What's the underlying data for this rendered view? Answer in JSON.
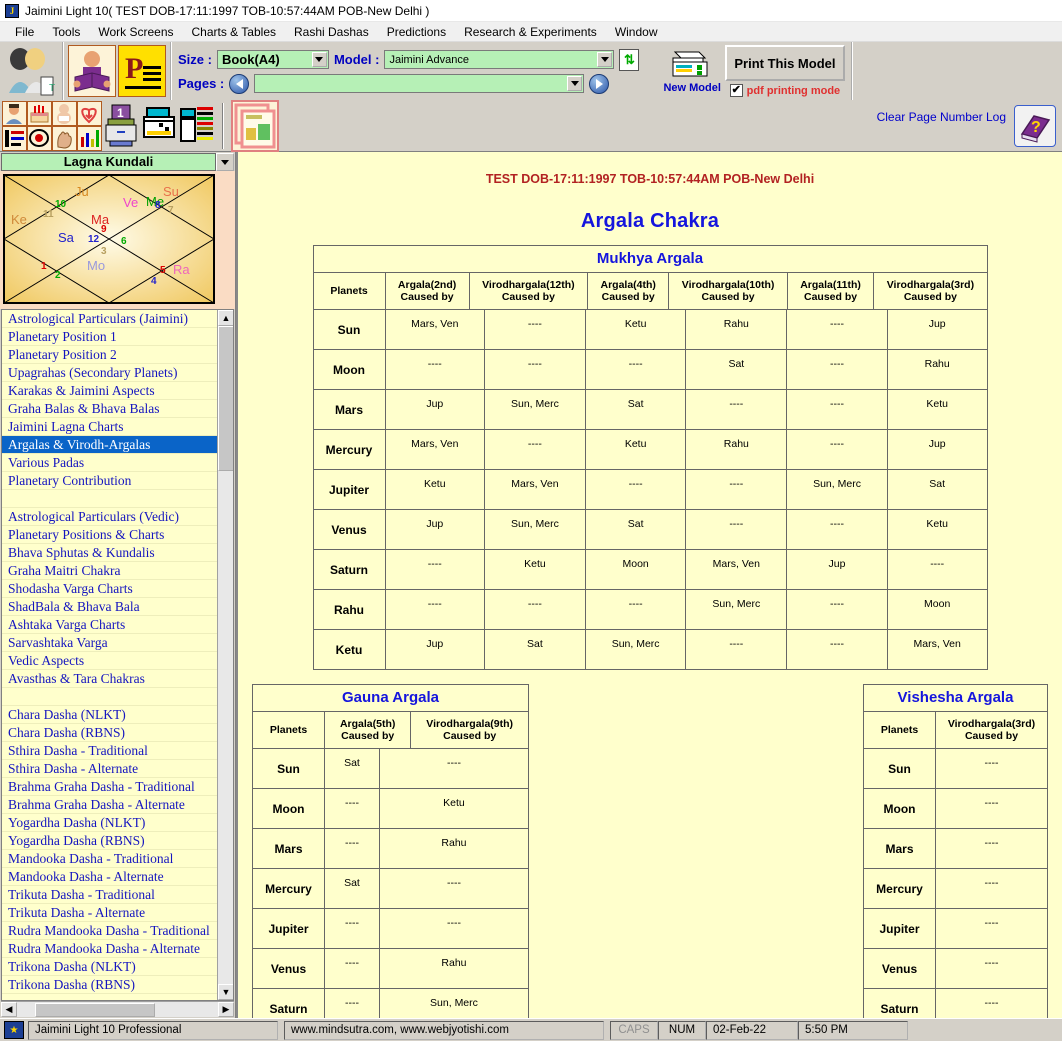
{
  "window": {
    "title": "Jaimini Light 10( TEST DOB-17:11:1997 TOB-10:57:44AM POB-New Delhi )",
    "app_icon": "J"
  },
  "menu": {
    "items": [
      "File",
      "Tools",
      "Work Screens",
      "Charts & Tables",
      "Rashi Dashas",
      "Predictions",
      "Research & Experiments",
      "Window"
    ]
  },
  "toolbar": {
    "size_label": "Size :",
    "size_value": "Book(A4)",
    "model_label": "Model :",
    "model_value": "Jaimini Advance",
    "pages_label": "Pages :",
    "pages_value": "",
    "new_model_label": "New Model",
    "print_label": "Print This Model",
    "pdf_checkbox_label": "pdf printing mode",
    "pdf_checked": "✔",
    "clear_log_label": "Clear Page Number Log"
  },
  "sidebar": {
    "header": "Lagna Kundali",
    "chart": {
      "planets": [
        {
          "name": "Ju",
          "color": "#d88a22"
        },
        {
          "name": "Su",
          "color": "#e8704a"
        },
        {
          "name": "Me",
          "color": "#00a000"
        },
        {
          "name": "Ve",
          "color": "#ee44cc"
        },
        {
          "name": "Ke",
          "color": "#d08a3a"
        },
        {
          "name": "Ma",
          "color": "#dd2222"
        },
        {
          "name": "Sa",
          "color": "#2222cc"
        },
        {
          "name": "Mo",
          "color": "#9999dd"
        },
        {
          "name": "Ra",
          "color": "#ee66bb"
        }
      ],
      "houses": [
        "1",
        "2",
        "3",
        "4",
        "5",
        "6",
        "7",
        "8",
        "9",
        "10",
        "11",
        "12"
      ]
    },
    "items": [
      {
        "label": "Astrological Particulars (Jaimini)",
        "selected": false
      },
      {
        "label": "Planetary Position 1",
        "selected": false
      },
      {
        "label": "Planetary Position 2",
        "selected": false
      },
      {
        "label": "Upagrahas (Secondary Planets)",
        "selected": false
      },
      {
        "label": "Karakas & Jaimini Aspects",
        "selected": false
      },
      {
        "label": "Graha Balas & Bhava Balas",
        "selected": false
      },
      {
        "label": "Jaimini Lagna Charts",
        "selected": false
      },
      {
        "label": "Argalas & Virodh-Argalas",
        "selected": true
      },
      {
        "label": "Various Padas",
        "selected": false
      },
      {
        "label": "Planetary Contribution",
        "selected": false
      },
      {
        "label": "",
        "selected": false
      },
      {
        "label": "Astrological Particulars (Vedic)",
        "selected": false
      },
      {
        "label": "Planetary Positions & Charts",
        "selected": false
      },
      {
        "label": "Bhava Sphutas & Kundalis",
        "selected": false
      },
      {
        "label": "Graha Maitri Chakra",
        "selected": false
      },
      {
        "label": "Shodasha Varga Charts",
        "selected": false
      },
      {
        "label": "ShadBala & Bhava Bala",
        "selected": false
      },
      {
        "label": "Ashtaka Varga Charts",
        "selected": false
      },
      {
        "label": "Sarvashtaka Varga",
        "selected": false
      },
      {
        "label": "Vedic Aspects",
        "selected": false
      },
      {
        "label": "Avasthas & Tara Chakras",
        "selected": false
      },
      {
        "label": "",
        "selected": false
      },
      {
        "label": "Chara Dasha (NLKT)",
        "selected": false
      },
      {
        "label": "Chara Dasha (RBNS)",
        "selected": false
      },
      {
        "label": "Sthira Dasha - Traditional",
        "selected": false
      },
      {
        "label": "Sthira Dasha - Alternate",
        "selected": false
      },
      {
        "label": "Brahma Graha Dasha - Traditional",
        "selected": false
      },
      {
        "label": "Brahma Graha Dasha - Alternate",
        "selected": false
      },
      {
        "label": "Yogardha Dasha (NLKT)",
        "selected": false
      },
      {
        "label": "Yogardha Dasha (RBNS)",
        "selected": false
      },
      {
        "label": "Mandooka Dasha - Traditional",
        "selected": false
      },
      {
        "label": "Mandooka Dasha - Alternate",
        "selected": false
      },
      {
        "label": "Trikuta Dasha - Traditional",
        "selected": false
      },
      {
        "label": "Trikuta Dasha - Alternate",
        "selected": false
      },
      {
        "label": "Rudra Mandooka Dasha - Traditional",
        "selected": false
      },
      {
        "label": "Rudra Mandooka Dasha - Alternate",
        "selected": false
      },
      {
        "label": "Trikona Dasha (NLKT)",
        "selected": false
      },
      {
        "label": "Trikona Dasha (RBNS)",
        "selected": false
      }
    ]
  },
  "content": {
    "subject_line": "TEST DOB-17:11:1997 TOB-10:57:44AM POB-New Delhi",
    "page_title": "Argala Chakra",
    "mukhya": {
      "caption": "Mukhya Argala",
      "columns": [
        "Planets",
        "Argala(2nd) Caused by",
        "Virodhargala(12th) Caused by",
        "Argala(4th) Caused by",
        "Virodhargala(10th) Caused by",
        "Argala(11th) Caused by",
        "Virodhargala(3rd) Caused by"
      ],
      "rows": [
        {
          "planet": "Sun",
          "values": [
            "Mars, Ven",
            "----",
            "Ketu",
            "Rahu",
            "----",
            "Jup"
          ]
        },
        {
          "planet": "Moon",
          "values": [
            "----",
            "----",
            "----",
            "Sat",
            "----",
            "Rahu"
          ]
        },
        {
          "planet": "Mars",
          "values": [
            "Jup",
            "Sun, Merc",
            "Sat",
            "----",
            "----",
            "Ketu"
          ]
        },
        {
          "planet": "Mercury",
          "values": [
            "Mars, Ven",
            "----",
            "Ketu",
            "Rahu",
            "----",
            "Jup"
          ]
        },
        {
          "planet": "Jupiter",
          "values": [
            "Ketu",
            "Mars, Ven",
            "----",
            "----",
            "Sun, Merc",
            "Sat"
          ]
        },
        {
          "planet": "Venus",
          "values": [
            "Jup",
            "Sun, Merc",
            "Sat",
            "----",
            "----",
            "Ketu"
          ]
        },
        {
          "planet": "Saturn",
          "values": [
            "----",
            "Ketu",
            "Moon",
            "Mars, Ven",
            "Jup",
            "----"
          ]
        },
        {
          "planet": "Rahu",
          "values": [
            "----",
            "----",
            "----",
            "Sun, Merc",
            "----",
            "Moon"
          ]
        },
        {
          "planet": "Ketu",
          "values": [
            "Jup",
            "Sat",
            "Sun, Merc",
            "----",
            "----",
            "Mars, Ven"
          ]
        }
      ]
    },
    "gauna": {
      "caption": "Gauna Argala",
      "columns": [
        "Planets",
        "Argala(5th) Caused by",
        "Virodhargala(9th) Caused by"
      ],
      "rows": [
        {
          "planet": "Sun",
          "values": [
            "Sat",
            "----"
          ]
        },
        {
          "planet": "Moon",
          "values": [
            "----",
            "Ketu"
          ]
        },
        {
          "planet": "Mars",
          "values": [
            "----",
            "Rahu"
          ]
        },
        {
          "planet": "Mercury",
          "values": [
            "Sat",
            "----"
          ]
        },
        {
          "planet": "Jupiter",
          "values": [
            "----",
            "----"
          ]
        },
        {
          "planet": "Venus",
          "values": [
            "----",
            "Rahu"
          ]
        },
        {
          "planet": "Saturn",
          "values": [
            "----",
            "Sun, Merc"
          ]
        }
      ]
    },
    "vishesha": {
      "caption": "Vishesha Argala",
      "columns": [
        "Planets",
        "Virodhargala(3rd) Caused by"
      ],
      "rows": [
        {
          "planet": "Sun",
          "values": [
            "----"
          ]
        },
        {
          "planet": "Moon",
          "values": [
            "----"
          ]
        },
        {
          "planet": "Mars",
          "values": [
            "----"
          ]
        },
        {
          "planet": "Mercury",
          "values": [
            "----"
          ]
        },
        {
          "planet": "Jupiter",
          "values": [
            "----"
          ]
        },
        {
          "planet": "Venus",
          "values": [
            "----"
          ]
        },
        {
          "planet": "Saturn",
          "values": [
            "----"
          ]
        }
      ]
    }
  },
  "statusbar": {
    "app_name": "Jaimini Light 10 Professional",
    "websites": "www.mindsutra.com, www.webjyotishi.com",
    "caps": "CAPS",
    "num": "NUM",
    "date": "02-Feb-22",
    "time": "5:50 PM"
  },
  "colors": {
    "content_bg": "#FFFFCC",
    "accent_blue": "#1515DD",
    "subject_red": "#B22222",
    "selection_blue": "#0A64C8",
    "combo_green": "#B6F0B6"
  }
}
